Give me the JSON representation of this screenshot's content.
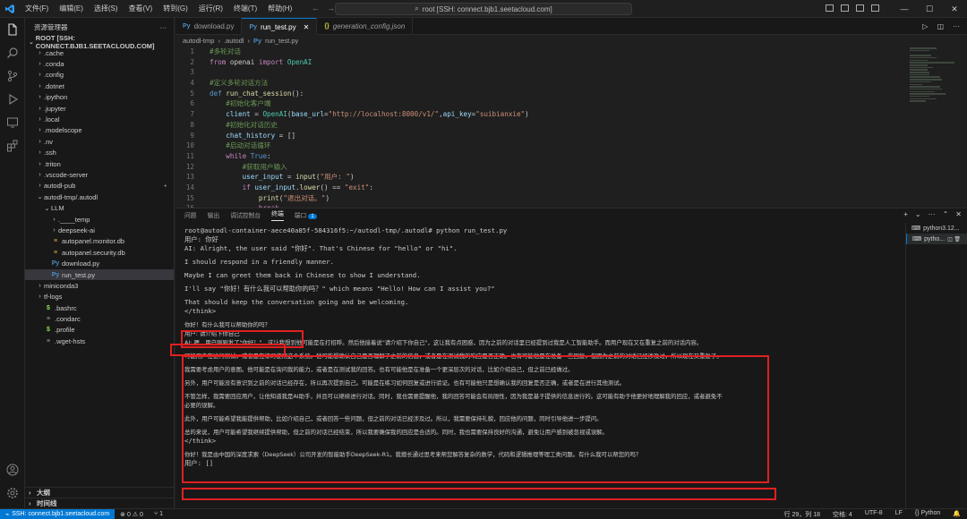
{
  "titlebar": {
    "menus": [
      "文件(F)",
      "编辑(E)",
      "选择(S)",
      "查看(V)",
      "转到(G)",
      "运行(R)",
      "终端(T)",
      "帮助(H)"
    ],
    "command_center": "root [SSH: connect.bjb1.seetacloud.com]",
    "window_controls": [
      "—",
      "☐",
      "✕"
    ]
  },
  "explorer": {
    "title": "资源管理器",
    "root": "ROOT [SSH: CONNECT.BJB1.SEETACLOUD.COM]",
    "items": [
      {
        "label": ".cache",
        "depth": 1,
        "type": "folder"
      },
      {
        "label": ".conda",
        "depth": 1,
        "type": "folder"
      },
      {
        "label": ".config",
        "depth": 1,
        "type": "folder"
      },
      {
        "label": ".dotnet",
        "depth": 1,
        "type": "folder"
      },
      {
        "label": ".ipython",
        "depth": 1,
        "type": "folder"
      },
      {
        "label": ".jupyter",
        "depth": 1,
        "type": "folder"
      },
      {
        "label": ".local",
        "depth": 1,
        "type": "folder"
      },
      {
        "label": ".modelscope",
        "depth": 1,
        "type": "folder"
      },
      {
        "label": ".nv",
        "depth": 1,
        "type": "folder"
      },
      {
        "label": ".ssh",
        "depth": 1,
        "type": "folder"
      },
      {
        "label": ".triton",
        "depth": 1,
        "type": "folder"
      },
      {
        "label": ".vscode-server",
        "depth": 1,
        "type": "folder"
      },
      {
        "label": "autodl-pub",
        "depth": 1,
        "type": "folder"
      },
      {
        "label": "autodl-tmp/.autodl",
        "depth": 1,
        "type": "folder-open"
      },
      {
        "label": "LLM",
        "depth": 2,
        "type": "folder-open"
      },
      {
        "label": ".____temp",
        "depth": 3,
        "type": "folder"
      },
      {
        "label": "deepseek-ai",
        "depth": 3,
        "type": "folder"
      },
      {
        "label": "autopanel.monitor.db",
        "depth": 2,
        "type": "db"
      },
      {
        "label": "autopanel.security.db",
        "depth": 2,
        "type": "db"
      },
      {
        "label": "download.py",
        "depth": 2,
        "type": "py"
      },
      {
        "label": "run_test.py",
        "depth": 2,
        "type": "py",
        "selected": true
      },
      {
        "label": "miniconda3",
        "depth": 1,
        "type": "folder"
      },
      {
        "label": "tf-logs",
        "depth": 1,
        "type": "folder"
      },
      {
        "label": ".bashrc",
        "depth": 1,
        "type": "sh"
      },
      {
        "label": ".condarc",
        "depth": 1,
        "type": "cfg"
      },
      {
        "label": ".profile",
        "depth": 1,
        "type": "sh"
      },
      {
        "label": ".wget-hsts",
        "depth": 1,
        "type": "cfg"
      }
    ],
    "outline": "大纲",
    "timeline": "时间线"
  },
  "editor": {
    "tabs": [
      {
        "label": "download.py",
        "icon": "py"
      },
      {
        "label": "run_test.py",
        "icon": "py",
        "active": true
      },
      {
        "label": "generation_config.json",
        "icon": "json"
      }
    ],
    "breadcrumb": [
      "autodl-tmp",
      ".autodl",
      "run_test.py"
    ],
    "lines": [
      {
        "n": "1",
        "segs": [
          [
            "c-com",
            "#多轮对话"
          ]
        ]
      },
      {
        "n": "2",
        "segs": [
          [
            "c-kw",
            "from"
          ],
          [
            "",
            " openai "
          ],
          [
            "c-kw",
            "import"
          ],
          [
            "c-cls",
            " OpenAI"
          ]
        ]
      },
      {
        "n": "3",
        "segs": []
      },
      {
        "n": "4",
        "segs": [
          [
            "c-com",
            "#定义多轮对话方法"
          ]
        ]
      },
      {
        "n": "5",
        "segs": [
          [
            "c-def",
            "def"
          ],
          [
            "",
            " "
          ],
          [
            "c-fn",
            "run_chat_session"
          ],
          [
            "",
            "():"
          ]
        ]
      },
      {
        "n": "6",
        "segs": [
          [
            "",
            "    "
          ],
          [
            "c-com",
            "#初始化客户端"
          ]
        ]
      },
      {
        "n": "7",
        "segs": [
          [
            "",
            "    "
          ],
          [
            "c-var",
            "client"
          ],
          [
            "",
            " = "
          ],
          [
            "c-cls",
            "OpenAI"
          ],
          [
            "",
            "("
          ],
          [
            "c-var",
            "base_url"
          ],
          [
            "",
            "="
          ],
          [
            "c-str",
            "\"http://localhost:8000/v1/\""
          ],
          [
            "",
            ","
          ],
          [
            "c-var",
            "api_key"
          ],
          [
            "",
            "="
          ],
          [
            "c-str",
            "\"suibianxie\""
          ],
          [
            "",
            ")"
          ]
        ]
      },
      {
        "n": "8",
        "segs": [
          [
            "",
            "    "
          ],
          [
            "c-com",
            "#初始化对话历史"
          ]
        ]
      },
      {
        "n": "9",
        "segs": [
          [
            "",
            "    "
          ],
          [
            "c-var",
            "chat_history"
          ],
          [
            "",
            " = []"
          ]
        ]
      },
      {
        "n": "10",
        "segs": [
          [
            "",
            "    "
          ],
          [
            "c-com",
            "#启动对话循环"
          ]
        ]
      },
      {
        "n": "11",
        "segs": [
          [
            "",
            "    "
          ],
          [
            "c-kw",
            "while"
          ],
          [
            "c-def",
            " True"
          ],
          [
            "",
            ":"
          ]
        ]
      },
      {
        "n": "12",
        "segs": [
          [
            "",
            "        "
          ],
          [
            "c-com",
            "#获取用户输入"
          ]
        ]
      },
      {
        "n": "13",
        "segs": [
          [
            "",
            "        "
          ],
          [
            "c-var",
            "user_input"
          ],
          [
            "",
            " = "
          ],
          [
            "c-fn",
            "input"
          ],
          [
            "",
            "("
          ],
          [
            "c-str",
            "\"用户: \""
          ],
          [
            "",
            ")"
          ]
        ]
      },
      {
        "n": "14",
        "segs": [
          [
            "",
            "        "
          ],
          [
            "c-kw",
            "if"
          ],
          [
            "",
            " "
          ],
          [
            "c-var",
            "user_input"
          ],
          [
            "",
            "."
          ],
          [
            "c-fn",
            "lower"
          ],
          [
            "",
            "() == "
          ],
          [
            "c-str",
            "\"exit\""
          ],
          [
            "",
            ":"
          ]
        ]
      },
      {
        "n": "15",
        "segs": [
          [
            "",
            "            "
          ],
          [
            "c-fn",
            "print"
          ],
          [
            "",
            "("
          ],
          [
            "c-str",
            "\"退出对话。\""
          ],
          [
            "",
            ")"
          ]
        ]
      },
      {
        "n": "16",
        "segs": [
          [
            "",
            "            "
          ],
          [
            "c-kw",
            "break"
          ]
        ]
      },
      {
        "n": "17",
        "segs": [
          [
            "",
            "        "
          ],
          [
            "c-com",
            "#更新对话历史(添加用户输入)"
          ]
        ]
      }
    ]
  },
  "panel": {
    "tabs": [
      "问题",
      "输出",
      "调试控制台",
      "终端",
      "端口"
    ],
    "active_tab": "终端",
    "ports_badge": "1",
    "terminal_lines": [
      {
        "t": "root@autodl-container-aece40a85f-584316f5:~/autodl-tmp/.autodl# python run_test.py",
        "cn": false
      },
      {
        "t": "用户: 你好",
        "cn": false
      },
      {
        "t": "AI: Alright, the user said \"你好\". That's Chinese for \"hello\" or \"hi\".",
        "cn": false
      },
      {
        "t": "",
        "cn": false,
        "gap": true
      },
      {
        "t": "I should respond in a friendly manner.",
        "cn": false
      },
      {
        "t": "",
        "cn": false,
        "gap": true
      },
      {
        "t": "Maybe I can greet them back in Chinese to show I understand.",
        "cn": false
      },
      {
        "t": "",
        "cn": false,
        "gap": true
      },
      {
        "t": "I'll say \"你好！有什么我可以帮助你的吗？\" which means \"Hello! How can I assist you?\"",
        "cn": false
      },
      {
        "t": "",
        "cn": false,
        "gap": true
      },
      {
        "t": "That should keep the conversation going and be welcoming.",
        "cn": false
      },
      {
        "t": "</think>",
        "cn": false
      },
      {
        "t": "",
        "cn": false,
        "gap": true
      },
      {
        "t": "你好！有什么我可以帮助你的吗？",
        "cn": true
      },
      {
        "t": "用户: 请介绍下你自己",
        "cn": true
      },
      {
        "t": "AI: 嗯，用户刚刚发了\"你好！\"，这让我想到他可能是在打招呼。然后他接着说\"请介绍下你自己\"，这让我有点困惑，因为之前的对话里已经提到过我是人工智能助手。而用户现在又在重复之前的对话内容。",
        "cn": true
      },
      {
        "t": "",
        "cn": false,
        "gap": true
      },
      {
        "t": "可能用户在进行测试，或者是在练习使用这个系统。他可能想确认自己是否理解了之前的信息，或者是在测试我的响应是否正确。也有可能他是在准备一些回复，但因为之前的对话已经涉及过，所以现在又重复了。",
        "cn": true
      },
      {
        "t": "",
        "cn": false,
        "gap": true
      },
      {
        "t": "我需要考虑用户的意图。他可能是在询问我的能力，或者是在测试我的回答。也有可能他是在准备一个更深层次的对话，比如介绍自己，但之前已经做过。",
        "cn": true
      },
      {
        "t": "",
        "cn": false,
        "gap": true
      },
      {
        "t": "另外，用户可能没有意识到之前的对话已经存在，所以再次提到自己。可能是在练习如何回复或进行验证。也有可能他只是想确认我的回复是否正确，或者是在进行其他测试。",
        "cn": true
      },
      {
        "t": "",
        "cn": false,
        "gap": true
      },
      {
        "t": "不管怎样，我需要回应用户，让他知道我是AI助手，并且可以继续进行对话。同时，我也需要提醒他，我的回答可能会有局限性，因为我是基于提供的信息进行的。这可能有助于他更好地理解我的回应，或者避免不",
        "cn": true
      },
      {
        "t": "必要的误解。",
        "cn": true
      },
      {
        "t": "",
        "cn": false,
        "gap": true
      },
      {
        "t": "此外，用户可能希望我能提供帮助，比如介绍自己，或者回答一些问题，但之前的对话已经涉及过。所以，我需要保持礼貌，回应他的问题，同时引导他进一步提问。",
        "cn": true
      },
      {
        "t": "",
        "cn": false,
        "gap": true
      },
      {
        "t": "总的来说，用户可能希望我继续提供帮助，但之前的对话已经结束，所以我要确保我的回应是合适的。同时，我也需要保持良好的沟通，避免让用户感到被忽视或误解。",
        "cn": true
      },
      {
        "t": "</think>",
        "cn": false
      },
      {
        "t": "",
        "cn": false,
        "gap": true
      },
      {
        "t": "你好！我是由中国的深度求索（DeepSeek）公司开发的智能助手DeepSeek-R1。我擅长通过思考来帮您解答复杂的数学，代码和逻辑推理等理工类问题。有什么我可以帮您的吗？",
        "cn": true
      },
      {
        "t": "用户: []",
        "cn": false
      }
    ],
    "terminals": [
      {
        "label": "python3.12...",
        "active": false
      },
      {
        "label": "pytho...",
        "active": true
      }
    ]
  },
  "status": {
    "remote": "SSH: connect.bjb1.seetacloud.com",
    "problems": "⊗ 0 ⚠ 0",
    "ports": "1",
    "right": [
      "行 29，列 18",
      "空格: 4",
      "UTF-8",
      "LF",
      "{} Python",
      "🔔"
    ]
  }
}
